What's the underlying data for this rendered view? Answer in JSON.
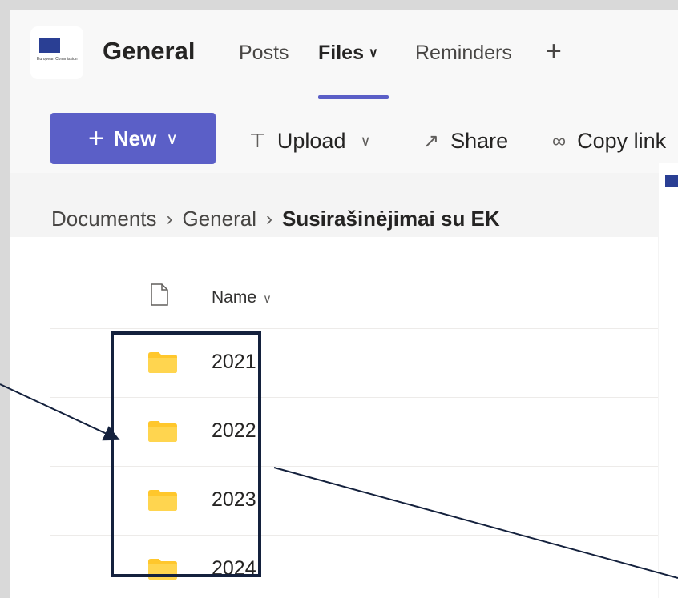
{
  "header": {
    "logo_text": "European Commission",
    "team_name": "General",
    "tabs": [
      {
        "label": "Posts"
      },
      {
        "label": "Files"
      },
      {
        "label": "Reminders"
      }
    ],
    "add_tab_symbol": "+"
  },
  "toolbar": {
    "new_label": "New",
    "upload_label": "Upload",
    "share_label": "Share",
    "copy_link_label": "Copy link"
  },
  "breadcrumb": {
    "items": [
      "Documents",
      "General"
    ],
    "current": "Susirašinėjimai su EK"
  },
  "list": {
    "name_header": "Name",
    "rows": [
      {
        "name": "2021",
        "icon": "folder-icon"
      },
      {
        "name": "2022",
        "icon": "folder-icon"
      },
      {
        "name": "2023",
        "icon": "folder-icon"
      },
      {
        "name": "2024",
        "icon": "folder-icon"
      }
    ]
  },
  "colors": {
    "accent": "#5b5fc7",
    "folder": "#ffc72c",
    "annotation": "#14213d"
  }
}
